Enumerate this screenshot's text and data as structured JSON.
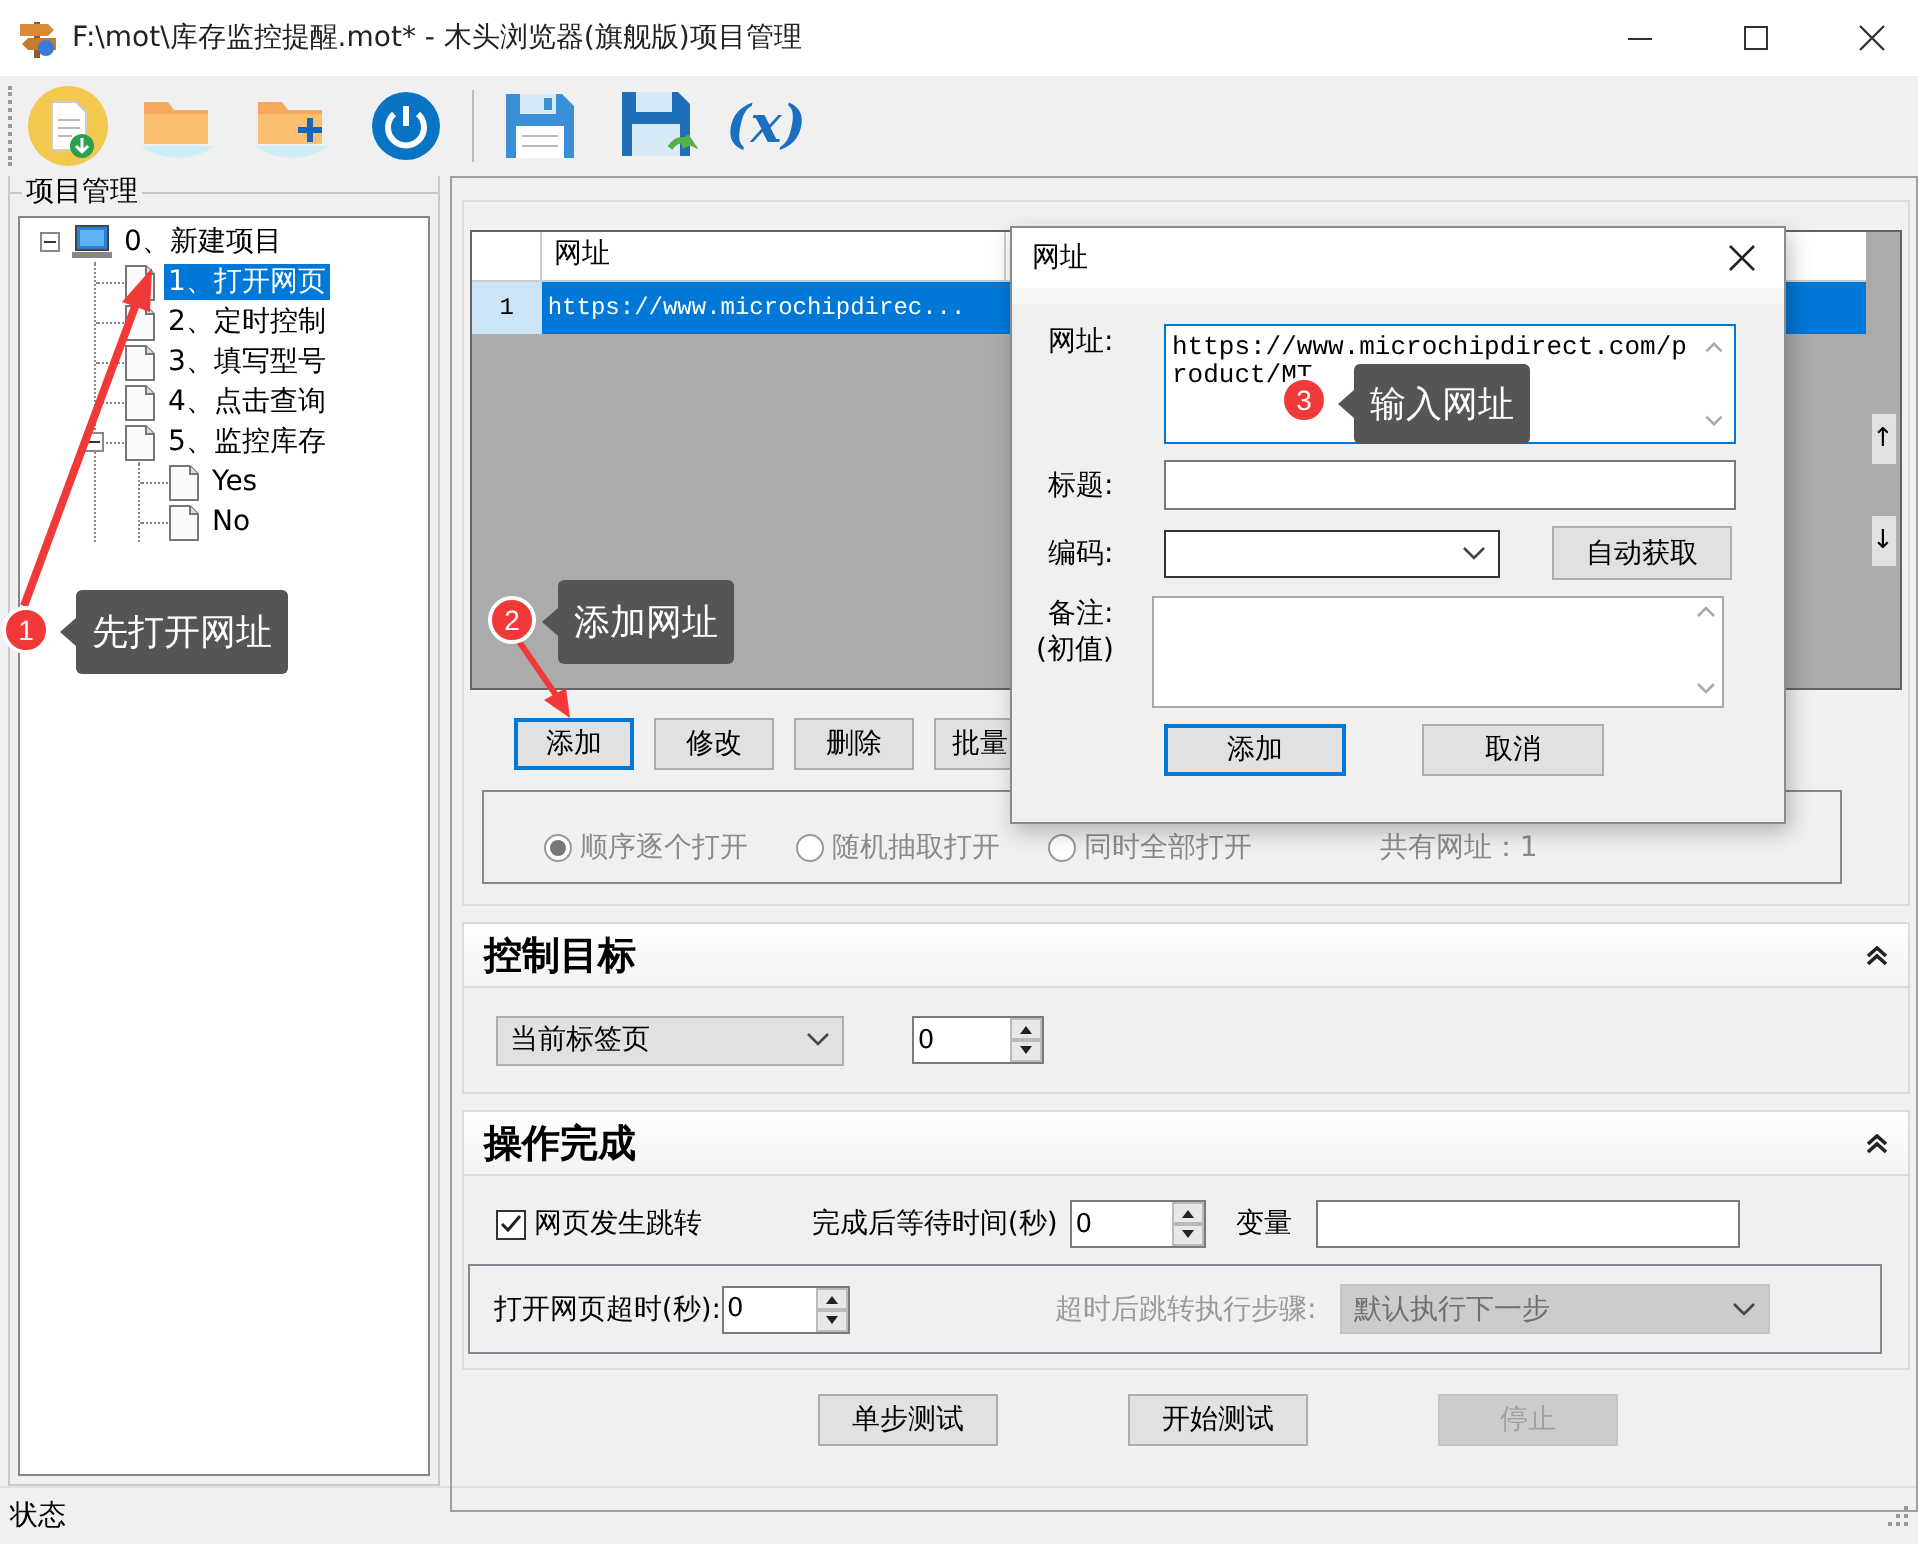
{
  "window": {
    "title": "F:\\mot\\库存监控提醒.mot* - 木头浏览器(旗舰版)项目管理"
  },
  "toolbar": {
    "variables_button": "(x)"
  },
  "tree": {
    "title": "项目管理",
    "nodes": [
      {
        "label": "0、新建项目",
        "selected": false,
        "expanded": true,
        "children": [
          {
            "label": "1、打开网页",
            "selected": true
          },
          {
            "label": "2、定时控制",
            "selected": false
          },
          {
            "label": "3、填写型号",
            "selected": false
          },
          {
            "label": "4、点击查询",
            "selected": false
          },
          {
            "label": "5、监控库存",
            "selected": false,
            "expanded": true,
            "children": [
              {
                "label": "Yes",
                "selected": false
              },
              {
                "label": "No",
                "selected": false
              }
            ]
          }
        ]
      }
    ]
  },
  "url_table": {
    "columns": [
      "网址"
    ],
    "rows": [
      {
        "number": "1",
        "url": "https://www.microchipdirec...",
        "selected": true
      }
    ],
    "move_buttons": [
      "↑",
      "↓"
    ]
  },
  "url_buttons": [
    {
      "label": "添加",
      "focused": true
    },
    {
      "label": "修改",
      "focused": false
    },
    {
      "label": "删除",
      "focused": false
    },
    {
      "label": "批量",
      "focused": false
    }
  ],
  "open_mode": {
    "disabled": true,
    "options": [
      {
        "label": "顺序逐个打开",
        "selected": true
      },
      {
        "label": "随机抽取打开",
        "selected": false
      },
      {
        "label": "同时全部打开",
        "selected": false
      }
    ],
    "count_label": "共有网址：1"
  },
  "control_target": {
    "title": "控制目标",
    "expanded": true,
    "target": "当前标签页",
    "index": "0"
  },
  "completion": {
    "title": "操作完成",
    "expanded": true,
    "page_jump": {
      "label": "网页发生跳转",
      "checked": true
    },
    "wait_label": "完成后等待时间(秒)",
    "wait": "0",
    "variable_label": "变量",
    "timeout_label": "打开网页超时(秒):",
    "timeout": "0",
    "timeout_step_label": "超时后跳转执行步骤:",
    "timeout_step": "默认执行下一步",
    "timeout_step_disabled": true
  },
  "test_buttons": [
    {
      "label": "单步测试",
      "disabled": false
    },
    {
      "label": "开始测试",
      "disabled": false
    },
    {
      "label": "停止",
      "disabled": true
    }
  ],
  "status_bar": {
    "text": "状态"
  },
  "dialog": {
    "title": "网址",
    "url_label": "网址:",
    "url": "https://www.microchipdirect.com/product/MT",
    "title_label": "标题:",
    "encoding_label": "编码:",
    "auto_button": "自动获取",
    "note_label": "备注:",
    "note_sublabel": "(初值)",
    "buttons": [
      {
        "label": "添加",
        "focused": true
      },
      {
        "label": "取消",
        "focused": false
      }
    ]
  },
  "callouts": [
    {
      "number": "1",
      "text": "先打开网址"
    },
    {
      "number": "2",
      "text": "添加网址"
    },
    {
      "number": "3",
      "text": "输入网址"
    }
  ]
}
